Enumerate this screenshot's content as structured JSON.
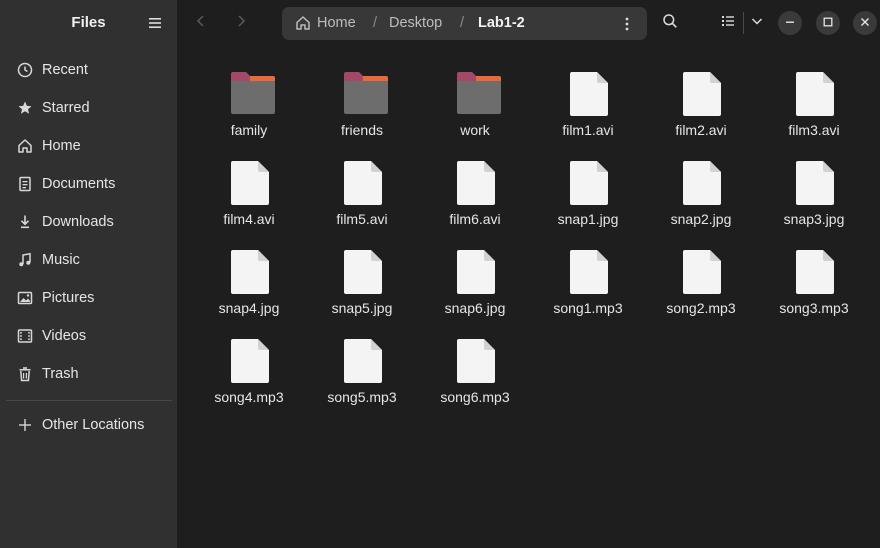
{
  "app": {
    "title": "Files"
  },
  "sidebar": {
    "items": [
      {
        "label": "Recent",
        "icon": "clock-icon"
      },
      {
        "label": "Starred",
        "icon": "star-icon"
      },
      {
        "label": "Home",
        "icon": "home-icon"
      },
      {
        "label": "Documents",
        "icon": "document-icon"
      },
      {
        "label": "Downloads",
        "icon": "download-icon"
      },
      {
        "label": "Music",
        "icon": "music-icon"
      },
      {
        "label": "Pictures",
        "icon": "picture-icon"
      },
      {
        "label": "Videos",
        "icon": "video-icon"
      },
      {
        "label": "Trash",
        "icon": "trash-icon"
      }
    ],
    "other_locations": "Other Locations"
  },
  "path": {
    "home": "Home",
    "separator": "/",
    "desktop": "Desktop",
    "current": "Lab1-2"
  },
  "files": [
    {
      "name": "family",
      "type": "folder"
    },
    {
      "name": "friends",
      "type": "folder"
    },
    {
      "name": "work",
      "type": "folder"
    },
    {
      "name": "film1.avi",
      "type": "file"
    },
    {
      "name": "film2.avi",
      "type": "file"
    },
    {
      "name": "film3.avi",
      "type": "file"
    },
    {
      "name": "film4.avi",
      "type": "file"
    },
    {
      "name": "film5.avi",
      "type": "file"
    },
    {
      "name": "film6.avi",
      "type": "file"
    },
    {
      "name": "snap1.jpg",
      "type": "file"
    },
    {
      "name": "snap2.jpg",
      "type": "file"
    },
    {
      "name": "snap3.jpg",
      "type": "file"
    },
    {
      "name": "snap4.jpg",
      "type": "file"
    },
    {
      "name": "snap5.jpg",
      "type": "file"
    },
    {
      "name": "snap6.jpg",
      "type": "file"
    },
    {
      "name": "song1.mp3",
      "type": "file"
    },
    {
      "name": "song2.mp3",
      "type": "file"
    },
    {
      "name": "song3.mp3",
      "type": "file"
    },
    {
      "name": "song4.mp3",
      "type": "file"
    },
    {
      "name": "song5.mp3",
      "type": "file"
    },
    {
      "name": "song6.mp3",
      "type": "file"
    }
  ],
  "colors": {
    "folder_tab": "#a34869",
    "folder_tab_accent": "#e66a3a",
    "folder_body": "#6d6d6d",
    "file_body": "#f4f4f4"
  }
}
